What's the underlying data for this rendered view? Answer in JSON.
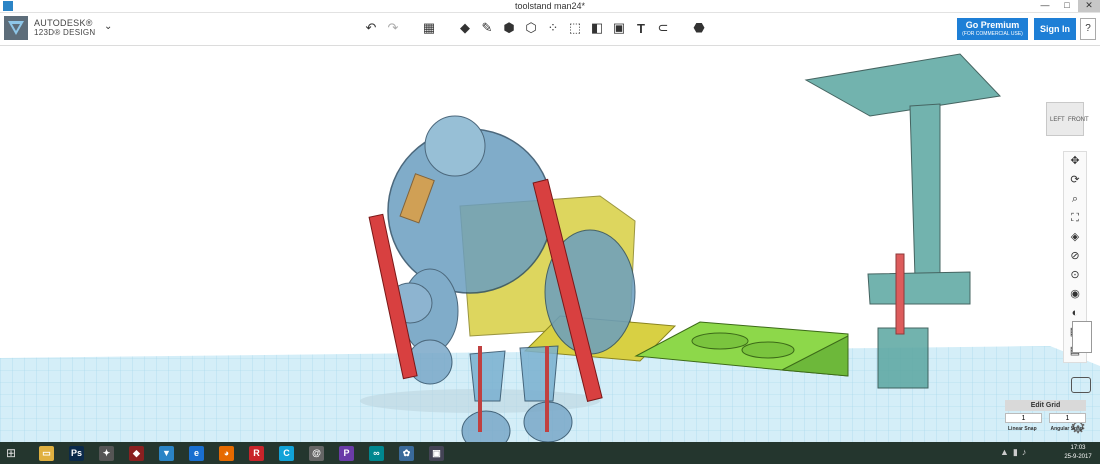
{
  "window": {
    "title": "toolstand man24*",
    "controls": [
      "—",
      "□",
      "✕"
    ]
  },
  "brand": {
    "company": "AUTODESK®",
    "product": "123D® DESIGN",
    "menu_glyph": "⌄"
  },
  "toolbar": {
    "undo_glyph": "↶",
    "redo_glyph": "↷",
    "tools": [
      {
        "name": "primitives-tool",
        "glyph": "◆"
      },
      {
        "name": "sketch-tool",
        "glyph": "✎"
      },
      {
        "name": "construct-tool",
        "glyph": "⬢"
      },
      {
        "name": "modify-tool",
        "glyph": "⬡"
      },
      {
        "name": "pattern-tool",
        "glyph": "⁘"
      },
      {
        "name": "grouping-tool",
        "glyph": "⬚"
      },
      {
        "name": "combine-tool",
        "glyph": "◧"
      },
      {
        "name": "measure-tool",
        "glyph": "▣"
      },
      {
        "name": "text-tool",
        "glyph": "T"
      },
      {
        "name": "snap-tool",
        "glyph": "⊂"
      }
    ],
    "material_glyph": "⬣",
    "premium_label": "Go Premium",
    "premium_sub": "(FOR COMMERCIAL USE)",
    "signin_label": "Sign In",
    "help_label": "?"
  },
  "viewcube": {
    "left": "LEFT",
    "front": "FRONT"
  },
  "nav": {
    "icons": [
      "✥",
      "⟳",
      "⌕",
      "⛶",
      "◈",
      "⊘",
      "⊙",
      "◉",
      "◐",
      "▨",
      "▤"
    ]
  },
  "grid": {
    "title": "Edit Grid",
    "linear_value": "1",
    "angular_value": "1",
    "linear_label": "Linear Snap",
    "angular_label": "Angular Snap"
  },
  "taskbar": {
    "start_glyph": "⊞",
    "apps": [
      {
        "name": "file-explorer",
        "glyph": "▭",
        "color": "#e0b040"
      },
      {
        "name": "photoshop",
        "glyph": "Ps",
        "color": "#0b2a4a"
      },
      {
        "name": "app-3",
        "glyph": "✦",
        "color": "#555"
      },
      {
        "name": "app-4",
        "glyph": "◆",
        "color": "#8a2020"
      },
      {
        "name": "123d-design",
        "glyph": "▼",
        "color": "#2b84c6"
      },
      {
        "name": "internet-explorer",
        "glyph": "e",
        "color": "#1a6fd0"
      },
      {
        "name": "firefox",
        "glyph": "◕",
        "color": "#e66a00"
      },
      {
        "name": "app-r",
        "glyph": "R",
        "color": "#c9242a"
      },
      {
        "name": "app-c",
        "glyph": "C",
        "color": "#11a3d8"
      },
      {
        "name": "app-g",
        "glyph": "@",
        "color": "#666"
      },
      {
        "name": "app-p",
        "glyph": "P",
        "color": "#6a3ca8"
      },
      {
        "name": "arduino",
        "glyph": "∞",
        "color": "#00878f"
      },
      {
        "name": "app-paint",
        "glyph": "✿",
        "color": "#3a6a9a"
      },
      {
        "name": "app-cube",
        "glyph": "▣",
        "color": "#445"
      }
    ],
    "time": "17:03",
    "date": "25-9-2017"
  }
}
